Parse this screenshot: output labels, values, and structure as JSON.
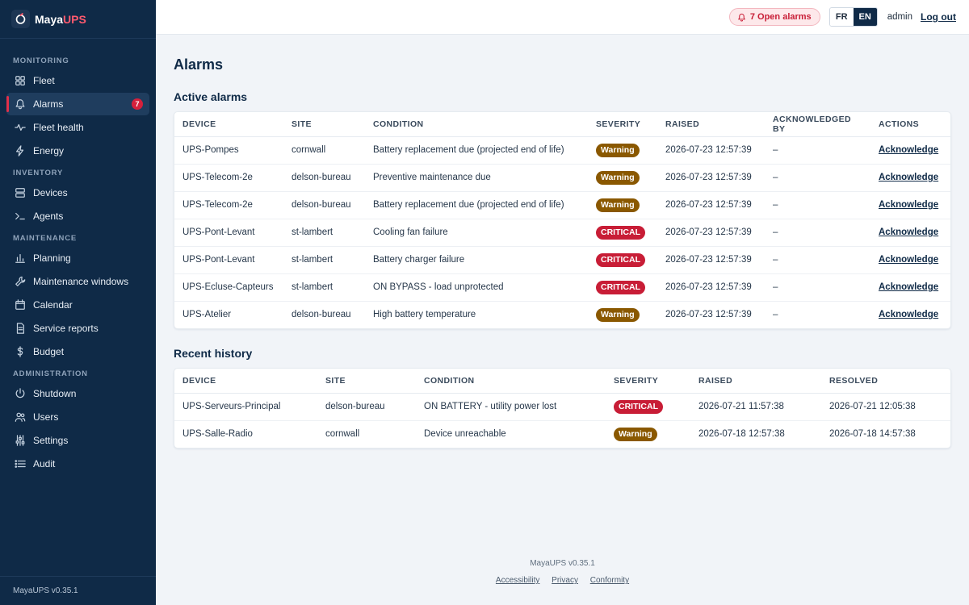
{
  "brand": {
    "name_main": "Maya",
    "name_accent": "UPS"
  },
  "sidebar": {
    "sections": [
      {
        "label": "MONITORING",
        "items": [
          {
            "label": "Fleet",
            "icon": "grid-icon"
          },
          {
            "label": "Alarms",
            "icon": "bell-icon",
            "badge": "7",
            "active": true
          },
          {
            "label": "Fleet health",
            "icon": "pulse-icon"
          },
          {
            "label": "Energy",
            "icon": "bolt-icon"
          }
        ]
      },
      {
        "label": "INVENTORY",
        "items": [
          {
            "label": "Devices",
            "icon": "server-icon"
          },
          {
            "label": "Agents",
            "icon": "terminal-icon"
          }
        ]
      },
      {
        "label": "MAINTENANCE",
        "items": [
          {
            "label": "Planning",
            "icon": "bar-chart-icon"
          },
          {
            "label": "Maintenance windows",
            "icon": "wrench-icon"
          },
          {
            "label": "Calendar",
            "icon": "calendar-icon"
          },
          {
            "label": "Service reports",
            "icon": "document-icon"
          },
          {
            "label": "Budget",
            "icon": "dollar-icon"
          }
        ]
      },
      {
        "label": "ADMINISTRATION",
        "items": [
          {
            "label": "Shutdown",
            "icon": "power-icon"
          },
          {
            "label": "Users",
            "icon": "users-icon"
          },
          {
            "label": "Settings",
            "icon": "sliders-icon"
          },
          {
            "label": "Audit",
            "icon": "list-icon"
          }
        ]
      }
    ],
    "footer": "MayaUPS v0.35.1"
  },
  "topbar": {
    "alarm_pill": "7 Open alarms",
    "lang_fr": "FR",
    "lang_en": "EN",
    "lang_selected": "EN",
    "user": "admin",
    "logout": "Log out"
  },
  "page": {
    "title": "Alarms"
  },
  "active_alarms": {
    "title": "Active alarms",
    "columns": [
      "DEVICE",
      "SITE",
      "CONDITION",
      "SEVERITY",
      "RAISED",
      "ACKNOWLEDGED BY",
      "ACTIONS"
    ],
    "rows": [
      {
        "device": "UPS-Pompes",
        "site": "cornwall",
        "condition": "Battery replacement due (projected end of life)",
        "severity": "Warning",
        "raised": "2026-07-23 12:57:39",
        "ack_by": "–",
        "action": "Acknowledge"
      },
      {
        "device": "UPS-Telecom-2e",
        "site": "delson-bureau",
        "condition": "Preventive maintenance due",
        "severity": "Warning",
        "raised": "2026-07-23 12:57:39",
        "ack_by": "–",
        "action": "Acknowledge"
      },
      {
        "device": "UPS-Telecom-2e",
        "site": "delson-bureau",
        "condition": "Battery replacement due (projected end of life)",
        "severity": "Warning",
        "raised": "2026-07-23 12:57:39",
        "ack_by": "–",
        "action": "Acknowledge"
      },
      {
        "device": "UPS-Pont-Levant",
        "site": "st-lambert",
        "condition": "Cooling fan failure",
        "severity": "CRITICAL",
        "raised": "2026-07-23 12:57:39",
        "ack_by": "–",
        "action": "Acknowledge"
      },
      {
        "device": "UPS-Pont-Levant",
        "site": "st-lambert",
        "condition": "Battery charger failure",
        "severity": "CRITICAL",
        "raised": "2026-07-23 12:57:39",
        "ack_by": "–",
        "action": "Acknowledge"
      },
      {
        "device": "UPS-Ecluse-Capteurs",
        "site": "st-lambert",
        "condition": "ON BYPASS - load unprotected",
        "severity": "CRITICAL",
        "raised": "2026-07-23 12:57:39",
        "ack_by": "–",
        "action": "Acknowledge"
      },
      {
        "device": "UPS-Atelier",
        "site": "delson-bureau",
        "condition": "High battery temperature",
        "severity": "Warning",
        "raised": "2026-07-23 12:57:39",
        "ack_by": "–",
        "action": "Acknowledge"
      }
    ]
  },
  "recent_history": {
    "title": "Recent history",
    "columns": [
      "DEVICE",
      "SITE",
      "CONDITION",
      "SEVERITY",
      "RAISED",
      "RESOLVED"
    ],
    "rows": [
      {
        "device": "UPS-Serveurs-Principal",
        "site": "delson-bureau",
        "condition": "ON BATTERY - utility power lost",
        "severity": "CRITICAL",
        "raised": "2026-07-21 11:57:38",
        "resolved": "2026-07-21 12:05:38"
      },
      {
        "device": "UPS-Salle-Radio",
        "site": "cornwall",
        "condition": "Device unreachable",
        "severity": "Warning",
        "raised": "2026-07-18 12:57:38",
        "resolved": "2026-07-18 14:57:38"
      }
    ]
  },
  "footer": {
    "version": "MayaUPS v0.35.1",
    "links": [
      "Accessibility",
      "Privacy",
      "Conformity"
    ]
  },
  "colors": {
    "sidebar_bg": "#0f2a47",
    "accent_red": "#c81d36",
    "warning": "#8a5800"
  }
}
